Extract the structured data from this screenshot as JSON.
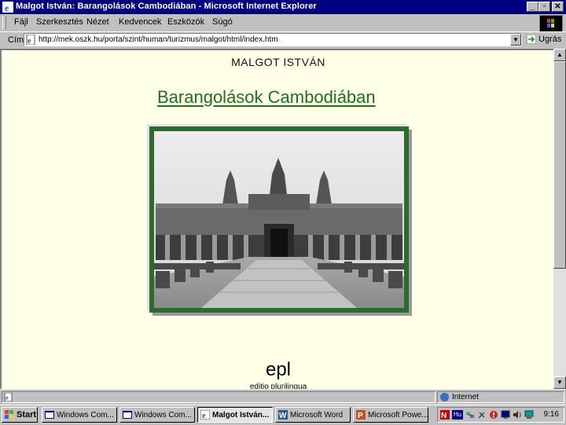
{
  "window": {
    "title": "Malgot István: Barangolások Cambodiában - Microsoft Internet Explorer",
    "controls": {
      "minimize": "_",
      "maximize": "▫",
      "close": "✕"
    }
  },
  "menu": {
    "items": [
      "Fájl",
      "Szerkesztés",
      "Nézet",
      "Kedvencek",
      "Eszközök",
      "Súgó"
    ]
  },
  "address": {
    "label": "Cím",
    "url": "http://mek.oszk.hu/porta/szint/human/turizmus/malgot/html/index.htm",
    "go_label": "Ugrás"
  },
  "page": {
    "author": "MALGOT ISTVÁN",
    "title": "Barangolások Cambodiában",
    "brand": "epl",
    "brand_sub": "editio plurilingua"
  },
  "status": {
    "zone": "Internet"
  },
  "taskbar": {
    "start_label": "Start",
    "tasks": [
      {
        "label": "Windows Com...",
        "active": false
      },
      {
        "label": "Windows Com...",
        "active": false
      },
      {
        "label": "Malgot István...",
        "active": true
      },
      {
        "label": "Microsoft Word",
        "active": false
      },
      {
        "label": "Microsoft Powe...",
        "active": false
      }
    ],
    "tray": {
      "language": "Hu",
      "clock": "9:16"
    }
  },
  "colors": {
    "titlebar": "#000080",
    "title_link": "#1e6f1e",
    "page_background": "#ffffe8",
    "photo_border": "#2e6b2e"
  }
}
